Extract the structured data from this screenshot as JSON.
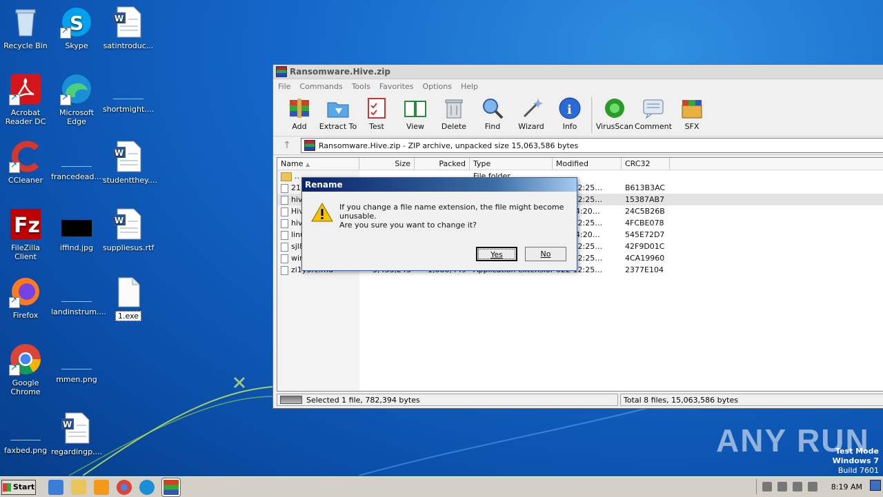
{
  "desktop": {
    "icons": [
      {
        "label": "Recycle Bin",
        "icon": "recycle-bin-icon"
      },
      {
        "label": "Skype",
        "icon": "skype-icon"
      },
      {
        "label": "satintroduc...",
        "icon": "word-doc-icon"
      },
      {
        "label": "Acrobat Reader DC",
        "icon": "acrobat-icon"
      },
      {
        "label": "Microsoft Edge",
        "icon": "edge-icon"
      },
      {
        "label": "shortmight....",
        "icon": "image-file-icon"
      },
      {
        "label": "CCleaner",
        "icon": "ccleaner-icon"
      },
      {
        "label": "francedead....",
        "icon": "image-file-icon"
      },
      {
        "label": "studentthey....",
        "icon": "word-doc-icon"
      },
      {
        "label": "FileZilla Client",
        "icon": "filezilla-icon"
      },
      {
        "label": "iffind.jpg",
        "icon": "image-file-icon"
      },
      {
        "label": "suppliesus.rtf",
        "icon": "word-doc-icon"
      },
      {
        "label": "Firefox",
        "icon": "firefox-icon"
      },
      {
        "label": "landinstrum....",
        "icon": "image-file-icon"
      },
      {
        "label": "1.exe",
        "icon": "exe-file-icon"
      },
      {
        "label": "Google Chrome",
        "icon": "chrome-icon"
      },
      {
        "label": "mmen.png",
        "icon": "image-file-icon"
      },
      {
        "label": "faxbed.png",
        "icon": "image-file-icon"
      },
      {
        "label": "regardingp....",
        "icon": "word-doc-icon"
      }
    ]
  },
  "window": {
    "title": "Ransomware.Hive.zip",
    "menu": [
      "File",
      "Commands",
      "Tools",
      "Favorites",
      "Options",
      "Help"
    ],
    "toolbar": [
      "Add",
      "Extract To",
      "Test",
      "View",
      "Delete",
      "Find",
      "Wizard",
      "Info",
      "VirusScan",
      "Comment",
      "SFX"
    ],
    "address": "Ransomware.Hive.zip - ZIP archive, unpacked size 15,063,586 bytes",
    "columns": {
      "name": "Name",
      "size": "Size",
      "packed": "Packed",
      "type": "Type",
      "modified": "Modified",
      "crc": "CRC32"
    },
    "rows": [
      {
        "name": "..",
        "size": "",
        "packed": "",
        "type": "File folder",
        "modified": "",
        "crc": ""
      },
      {
        "name": "21",
        "size": "",
        "packed": "",
        "type": "",
        "modified": "022 12:25…",
        "crc": "B613B3AC"
      },
      {
        "name": "hiv",
        "size": "",
        "packed": "",
        "type": "",
        "modified": "022 12:25…",
        "crc": "15387AB7"
      },
      {
        "name": "Hiv",
        "size": "",
        "packed": "",
        "type": "",
        "modified": ".601 4:20…",
        "crc": "24C5B26B"
      },
      {
        "name": "hiv",
        "size": "",
        "packed": "",
        "type": "",
        "modified": "022 12:25…",
        "crc": "4FCBE078"
      },
      {
        "name": "linu",
        "size": "",
        "packed": "",
        "type": "",
        "modified": ".601 4:20…",
        "crc": "545E72D7"
      },
      {
        "name": "sjl8",
        "size": "",
        "packed": "",
        "type": "",
        "modified": "022 12:25…",
        "crc": "42F9D01C"
      },
      {
        "name": "wir",
        "size": "",
        "packed": "",
        "type": "",
        "modified": "022 12:25…",
        "crc": "4CA19960"
      },
      {
        "name": "zi1y5rc.md",
        "size": "3,433,243",
        "packed": "1,086,449",
        "type": "Application extension",
        "modified": "022 12:25…",
        "crc": "2377E104"
      }
    ],
    "status_left": "Selected 1 file, 782,394 bytes",
    "status_right": "Total 8 files, 15,063,586 bytes"
  },
  "dialog": {
    "title": "Rename",
    "message": "If you change a file name extension, the file might become unusable.",
    "question": "Are you sure you want to change it?",
    "yes": "Yes",
    "no": "No"
  },
  "watermark": {
    "brand": "ANY RUN",
    "mode": "Test Mode",
    "os": "Windows 7",
    "build": "Build 7601"
  },
  "taskbar": {
    "start": "Start",
    "clock": "8:19 AM"
  }
}
